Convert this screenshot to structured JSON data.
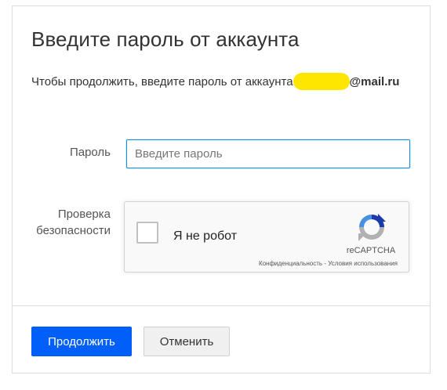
{
  "dialog": {
    "title": "Введите пароль от аккаунта",
    "subtitle_prefix": "Чтобы продолжить, введите пароль от аккаунта",
    "subtitle_domain": "@mail.ru"
  },
  "form": {
    "password_label": "Пароль",
    "password_placeholder": "Введите пароль",
    "security_label_line1": "Проверка",
    "security_label_line2": "безопасности"
  },
  "recaptcha": {
    "checkbox_label": "Я не робот",
    "brand": "reCAPTCHA",
    "privacy_link": "Конфиденциальность",
    "separator": " - ",
    "terms_link": "Условия использования",
    "logo_colors": [
      "#1c3aa9",
      "#4a90e2",
      "#b1b1b1"
    ]
  },
  "footer": {
    "continue_label": "Продолжить",
    "cancel_label": "Отменить"
  },
  "colors": {
    "primary": "#005ff9",
    "input_focus": "#168de2",
    "redaction": "#ffe600"
  }
}
